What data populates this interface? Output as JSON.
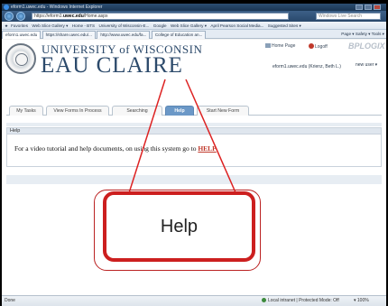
{
  "window": {
    "title": "eform1.uwec.edu - Windows Internet Explorer"
  },
  "address_bar": {
    "url_prefix": "https://eform1.",
    "url_domain": "uwec.edu",
    "url_suffix": "/Home.aspx",
    "search_placeholder": "Windows Live Search"
  },
  "favorites_bar": {
    "label": "Favorites",
    "items": [
      "Web Slice Gallery ▾",
      "Home - BTS",
      "University of Wisconsin-E...",
      "Google",
      "Web Slice Gallery ▾",
      "April Pearson Social Media...",
      "Suggested Sites ▾"
    ]
  },
  "browser_tabs": {
    "tabs": [
      "eform1.uwec.edu",
      "https://share.uwec.edu/...",
      "http://www.uwec.edu/fa...",
      "College of Education an..."
    ],
    "tools": "Page ▾  Safety ▾  Tools ▾"
  },
  "header": {
    "university_line": "UNIVERSITY of WISCONSIN",
    "campus_line": "EAU CLAIRE",
    "home_page_label": "Home Page",
    "logoff_label": "Logoff",
    "vendor_logo": "BPLOGIX",
    "user_line": "eform1.uwec.edu (Krienz, Beth L.)",
    "new_user_label": "new user ▾"
  },
  "app_tabs": [
    "My Tasks",
    "View Forms In Process",
    "Searching",
    "Help",
    "Start New Form"
  ],
  "help_section": {
    "heading": "Help",
    "body_text": "For a video tutorial and help documents, on using this system go to ",
    "link_label": "HELP"
  },
  "callout": {
    "label": "Help"
  },
  "status_bar": {
    "left": "Done",
    "zone": "Local intranet | Protected Mode: Off",
    "zoom": "▾ 100%"
  }
}
